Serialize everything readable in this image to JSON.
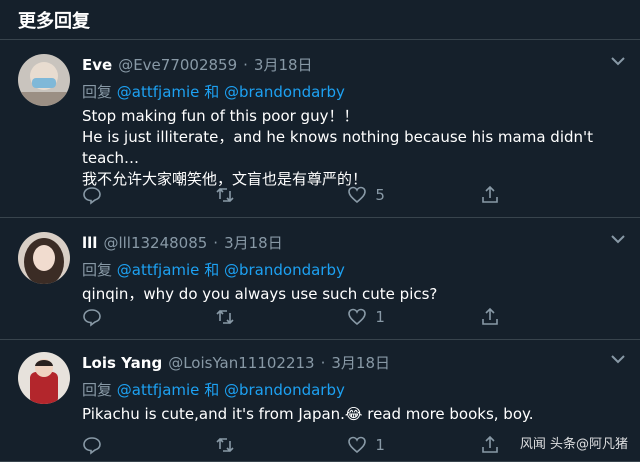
{
  "header": {
    "title": "更多回复"
  },
  "tweets": [
    {
      "name": "Eve",
      "handle": "@Eve77002859",
      "date": "3月18日",
      "reply_prefix": "回复",
      "mention1": "@attfjamie",
      "and": "和",
      "mention2": "@brandondarby",
      "lines": [
        "Stop making fun of this poor guy！！",
        "He is just illiterate，and he knows nothing because his mama didn't teach…",
        "我不允许大家嘲笑他，文盲也是有尊严的！"
      ],
      "like_count": "5"
    },
    {
      "name": "lll",
      "handle": "@lll13248085",
      "date": "3月18日",
      "reply_prefix": "回复",
      "mention1": "@attfjamie",
      "and": "和",
      "mention2": "@brandondarby",
      "lines": [
        "qinqin，why do you always use such cute pics?"
      ],
      "like_count": "1"
    },
    {
      "name": "Lois Yang",
      "handle": "@LoisYan11102213",
      "date": "3月18日",
      "reply_prefix": "回复",
      "mention1": "@attfjamie",
      "and": "和",
      "mention2": "@brandondarby",
      "lines": [
        "Pikachu is cute,and it's from Japan.😂 read more books, boy."
      ],
      "like_count": "1"
    }
  ],
  "watermark": "风闻 头条@阿凡猪",
  "colors": {
    "bg": "#15202b",
    "accent": "#1da1f2",
    "muted": "#8899a6",
    "border": "#38444d"
  },
  "icons": [
    "reply-icon",
    "retweet-icon",
    "like-icon",
    "share-icon",
    "chevron-down-icon"
  ]
}
